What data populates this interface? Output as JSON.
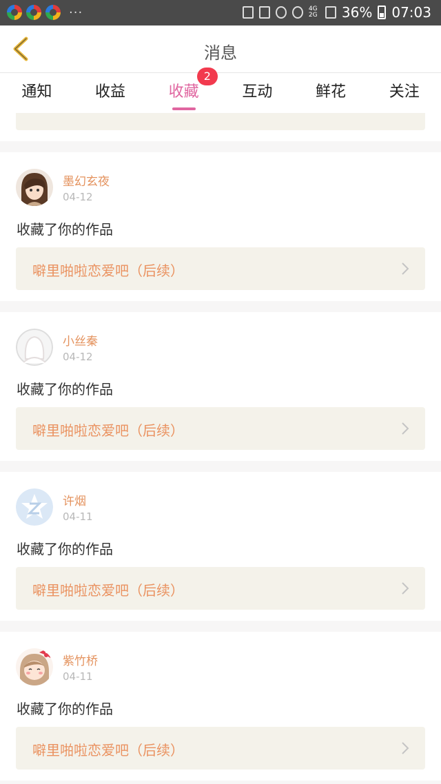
{
  "status_bar": {
    "dots": "···",
    "network": "4G 2G",
    "battery": "36%",
    "time": "07:03"
  },
  "header": {
    "title": "消息"
  },
  "tabs": [
    {
      "label": "通知"
    },
    {
      "label": "收益"
    },
    {
      "label": "收藏",
      "badge": "2",
      "active": true
    },
    {
      "label": "互动"
    },
    {
      "label": "鲜花"
    },
    {
      "label": "关注"
    }
  ],
  "items": [
    {
      "username": "墨幻玄夜",
      "date": "04-12",
      "action": "收藏了你的作品",
      "work_title": "噼里啪啦恋爱吧（后续）",
      "avatar": "avatar-anime-boy"
    },
    {
      "username": "小丝秦",
      "date": "04-12",
      "action": "收藏了你的作品",
      "work_title": "噼里啪啦恋爱吧（后续）",
      "avatar": "avatar-default"
    },
    {
      "username": "许烟",
      "date": "04-11",
      "action": "收藏了你的作品",
      "work_title": "噼里啪啦恋爱吧（后续）",
      "avatar": "avatar-qq"
    },
    {
      "username": "紫竹桥",
      "date": "04-11",
      "action": "收藏了你的作品",
      "work_title": "噼里啪啦恋爱吧（后续）",
      "avatar": "avatar-anime-girl"
    }
  ],
  "colors": {
    "accent": "#e066a0",
    "badge": "#f23a4e",
    "username": "#e4935f",
    "work_title": "#ea9260",
    "link_bg": "#f4f2ea"
  }
}
